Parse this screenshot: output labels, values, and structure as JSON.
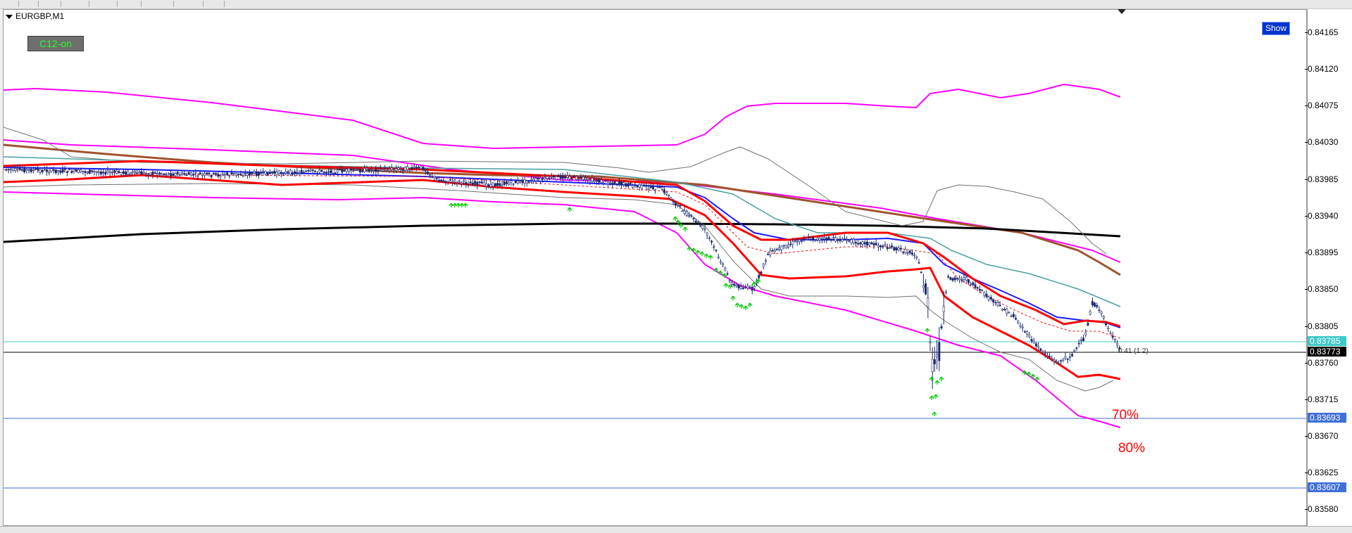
{
  "window": {
    "symbol": "EURGBP,M1"
  },
  "buttons": {
    "c12": "C12-on",
    "show": "Show"
  },
  "annotations": {
    "pct70": "70%",
    "pct80": "80%",
    "spread": "0:41 (1.2)"
  },
  "price_axis": {
    "ticks": [
      "0.84165",
      "0.84120",
      "0.84075",
      "0.84030",
      "0.83985",
      "0.83940",
      "0.83895",
      "0.83850",
      "0.83805",
      "0.83760",
      "0.83715",
      "0.83670",
      "0.83625",
      "0.83580"
    ],
    "labels": {
      "teal": "0.83785",
      "current": "0.83773",
      "blue1": "0.83693",
      "blue2": "0.83607"
    }
  },
  "colors": {
    "magenta": "#ff00ff",
    "red": "#ff0000",
    "blue": "#1a1aff",
    "brown": "#a0522d",
    "black": "#000000",
    "teal": "#48a0a0",
    "candle": "#1c2a6e",
    "arrow": "#00cc00",
    "grey": "#707070",
    "label_blue": "#3f6fd8",
    "label_teal": "#40c8c8"
  },
  "icons": {
    "symbol_menu": "triangle-down-icon",
    "chart_shift": "chart-shift-marker-icon",
    "buy_arrow": "green-up-arrow-icon"
  }
}
